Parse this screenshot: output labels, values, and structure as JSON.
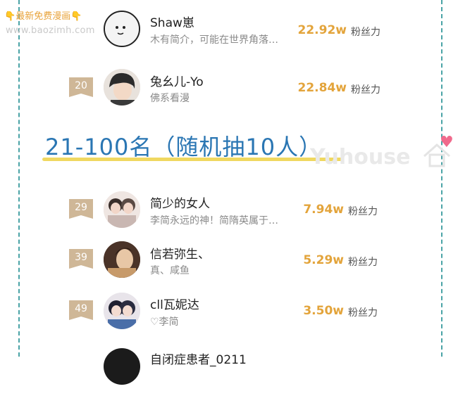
{
  "watermark": {
    "label": "最新免费漫画",
    "url": "www.baozimh.com"
  },
  "section": {
    "title": "21-100名（随机抽10人）",
    "logo_text": "Yuhouse"
  },
  "colors": {
    "accent": "#e3a43b",
    "title_blue": "#2a76b3",
    "rank_tag": "#cfb797",
    "frame": "#4aa3a6"
  },
  "rows": [
    {
      "rank": "",
      "name": "Shaw崽",
      "desc": "木有简介，可能在世界角落…",
      "fans": "22.92w",
      "unit": "粉丝力"
    },
    {
      "rank": "20",
      "name": "兔幺儿-Yo",
      "desc": "佛系看漫",
      "fans": "22.84w",
      "unit": "粉丝力"
    },
    {
      "rank": "29",
      "name": "简少的女人",
      "desc": "李简永远的神！简隋英属于…",
      "fans": "7.94w",
      "unit": "粉丝力"
    },
    {
      "rank": "39",
      "name": "信若弥生、",
      "desc": "真、咸鱼",
      "fans": "5.29w",
      "unit": "粉丝力"
    },
    {
      "rank": "49",
      "name": "cll瓦妮达",
      "desc": "♡李简",
      "fans": "3.50w",
      "unit": "粉丝力"
    },
    {
      "rank": "",
      "name": "自闭症患者_0211",
      "desc": "",
      "fans": "",
      "unit": ""
    }
  ]
}
